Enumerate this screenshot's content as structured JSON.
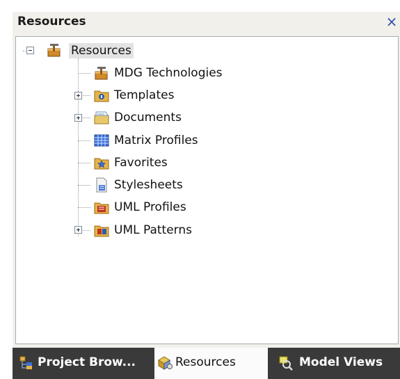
{
  "panel": {
    "title": "Resources",
    "close_glyph": "×"
  },
  "tree": {
    "root": {
      "label": "Resources",
      "icon": "resources-toolbox-icon",
      "expanded": true
    },
    "children": [
      {
        "label": "MDG Technologies",
        "icon": "mdg-technologies-icon",
        "expandable": false
      },
      {
        "label": "Templates",
        "icon": "templates-folder-icon",
        "expandable": true
      },
      {
        "label": "Documents",
        "icon": "documents-folder-icon",
        "expandable": true
      },
      {
        "label": "Matrix Profiles",
        "icon": "matrix-profiles-icon",
        "expandable": false
      },
      {
        "label": "Favorites",
        "icon": "favorites-folder-icon",
        "expandable": false
      },
      {
        "label": "Stylesheets",
        "icon": "stylesheets-icon",
        "expandable": false
      },
      {
        "label": "UML Profiles",
        "icon": "uml-profiles-icon",
        "expandable": false
      },
      {
        "label": "UML Patterns",
        "icon": "uml-patterns-icon",
        "expandable": true
      }
    ]
  },
  "tabs": [
    {
      "label": "Project Brow...",
      "icon": "project-browser-icon",
      "active": false
    },
    {
      "label": "Resources",
      "icon": "resources-tab-icon",
      "active": true
    },
    {
      "label": "Model Views",
      "icon": "model-views-icon",
      "active": false
    }
  ]
}
